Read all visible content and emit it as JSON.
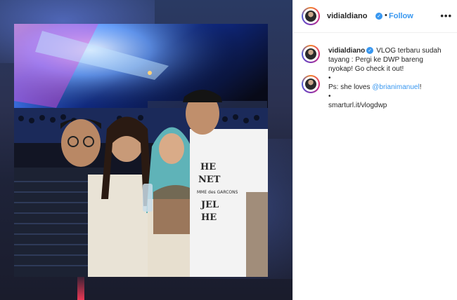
{
  "post": {
    "username": "vidialdiano",
    "follow_label": "Follow",
    "separator": "•",
    "more_label": "•••",
    "verified_mark": "✓"
  },
  "caption": {
    "username": "vidialdiano",
    "text": "VLOG terbaru sudah tayang : Pergi ke DWP bareng nyokap! Go check it out!",
    "bullet1": "•",
    "ps_prefix": "Ps: she loves ",
    "ps_mention": "@brianimanuel",
    "ps_suffix": "!",
    "bullet2": "•",
    "link": "smarturl.it/vlogdwp"
  },
  "colors": {
    "accent": "#3897f0",
    "text": "#262626",
    "divider": "#efefef"
  },
  "icons": {
    "more": "more-options-icon",
    "verified": "verified-badge-icon"
  }
}
